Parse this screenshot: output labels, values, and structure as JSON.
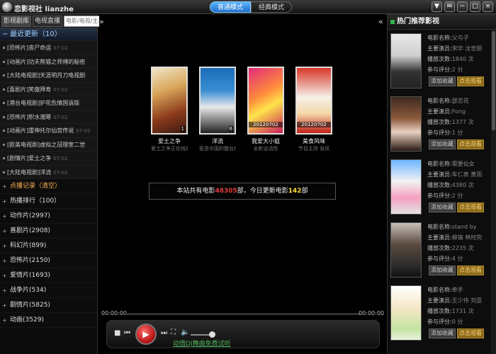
{
  "app": {
    "title": "恋影视社 lianzhe"
  },
  "modes": [
    "普通模式",
    "经典模式"
  ],
  "window_buttons": [
    "▼",
    "✉",
    "−",
    "□",
    "×"
  ],
  "sidebar": {
    "tabs": [
      "影视剧库",
      "电视直播"
    ],
    "search_placeholder": "电影/电视/主演",
    "recent_header": "最近更新（10）",
    "recent_items": [
      {
        "text": "[恐怖片]丧尸命运",
        "date": "07-02"
      },
      {
        "text": "[动画片]功夫熊猫之师傅的秘密",
        "date": ""
      },
      {
        "text": "[大陆电视剧]天涯明月刀电视剧",
        "date": ""
      },
      {
        "text": "[喜剧片]笑傲拜寿",
        "date": "07-02"
      },
      {
        "text": "[港台电视剧]护花危情国语版",
        "date": ""
      },
      {
        "text": "[恐怖片]积水潮寒",
        "date": "07-02"
      },
      {
        "text": "[动画片]雷神托尔仙宫传说",
        "date": "07-02"
      },
      {
        "text": "[欧美电视剧]虚拟之冠理室二世",
        "date": ""
      },
      {
        "text": "[剧情片]爱土之争",
        "date": "07-02"
      },
      {
        "text": "[大陆电视剧]洋流",
        "date": "07-02"
      }
    ],
    "categories": [
      {
        "label": "点播记录（清空）",
        "hl": true
      },
      {
        "label": "热播排行（100）"
      },
      {
        "label": "动作片(2997)"
      },
      {
        "label": "喜剧片(2908)"
      },
      {
        "label": "科幻片(899)"
      },
      {
        "label": "恐怖片(2150)"
      },
      {
        "label": "爱情片(1693)"
      },
      {
        "label": "战争片(534)"
      },
      {
        "label": "剧情片(5825)"
      },
      {
        "label": "动画(3529)"
      }
    ]
  },
  "main": {
    "posters": [
      {
        "title": "爱土之争",
        "sub": "爱土之争正在线观",
        "badge": "1"
      },
      {
        "title": "洋流",
        "sub": "惹恶中国的整台作",
        "badge": "6"
      },
      {
        "title": "我爱大小姐",
        "sub": "全新谈话性",
        "badge": "",
        "date": "20120702"
      },
      {
        "title": "美食风味",
        "sub": "节目主持 张凤",
        "badge": "",
        "date": "20120702"
      }
    ],
    "banner": {
      "prefix": "本站共有电影",
      "total": "48305",
      "mid": "部，今日更新电影",
      "today": "142",
      "suffix": "部"
    }
  },
  "player": {
    "time_current": "00:00:00",
    "time_total": "00:00:00",
    "promo_link": "动借DJ舞曲免费试听"
  },
  "right_panel": {
    "title": "热门推荐影视",
    "labels": {
      "name": "电影名称:",
      "cast": "主要演员:",
      "plays": "播放次数:",
      "score": "参与评分:"
    },
    "fav_label": "添加收藏",
    "watch_label": "点击观看",
    "items": [
      {
        "name": "父与子",
        "cast": "宋华 沈世朋",
        "plays": "1840 次",
        "score": "2 分"
      },
      {
        "name": "瑟恋花",
        "cast": "Fong",
        "plays": "1377 次",
        "score": "1 分"
      },
      {
        "name": "需要仙女",
        "cast": "车仁表 黄雨",
        "plays": "4380 次",
        "score": "2 分"
      },
      {
        "name": "stand by",
        "cast": "柳镐 林时完",
        "plays": "2235 次",
        "score": "4 分"
      },
      {
        "name": "牵手",
        "cast": "王少伟 刘亚",
        "plays": "1731 次",
        "score": "0 分"
      }
    ]
  }
}
